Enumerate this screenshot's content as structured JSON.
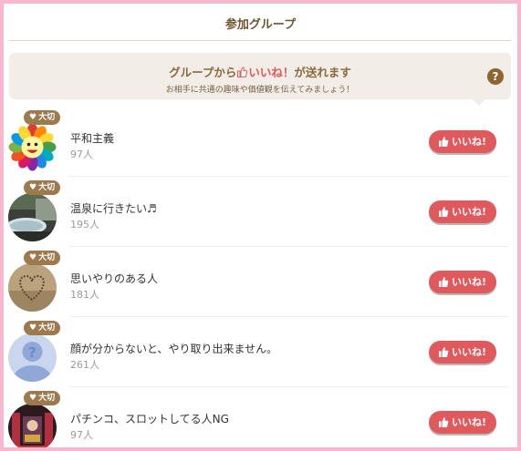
{
  "header": {
    "title": "参加グループ"
  },
  "banner": {
    "title_pre": "グループから",
    "title_iine": "いいね！",
    "title_post": "が送れます",
    "subtitle": "お相手に共通の趣味や価値観を伝えてみましょう！",
    "help_label": "?"
  },
  "groups": [
    {
      "badge": "大切",
      "name": "平和主義",
      "count": "97人",
      "button": "いいね!"
    },
    {
      "badge": "大切",
      "name": "温泉に行きたい♬",
      "count": "195人",
      "button": "いいね!"
    },
    {
      "badge": "大切",
      "name": "思いやりのある人",
      "count": "181人",
      "button": "いいね!"
    },
    {
      "badge": "大切",
      "name": "顔が分からないと、やり取り出来ません。",
      "count": "261人",
      "button": "いいね!"
    },
    {
      "badge": "大切",
      "name": "パチンコ、スロットしてる人NG",
      "count": "97人",
      "button": "いいね!"
    }
  ],
  "colors": {
    "frame": "#f6b7cf",
    "accent_brown": "#8a6a3c",
    "like_red": "#e0595c",
    "badge_brown": "#9c7a4d"
  },
  "icons": {
    "badge": "heart-icon",
    "button": "thumbs-up-icon",
    "help": "question-icon"
  }
}
